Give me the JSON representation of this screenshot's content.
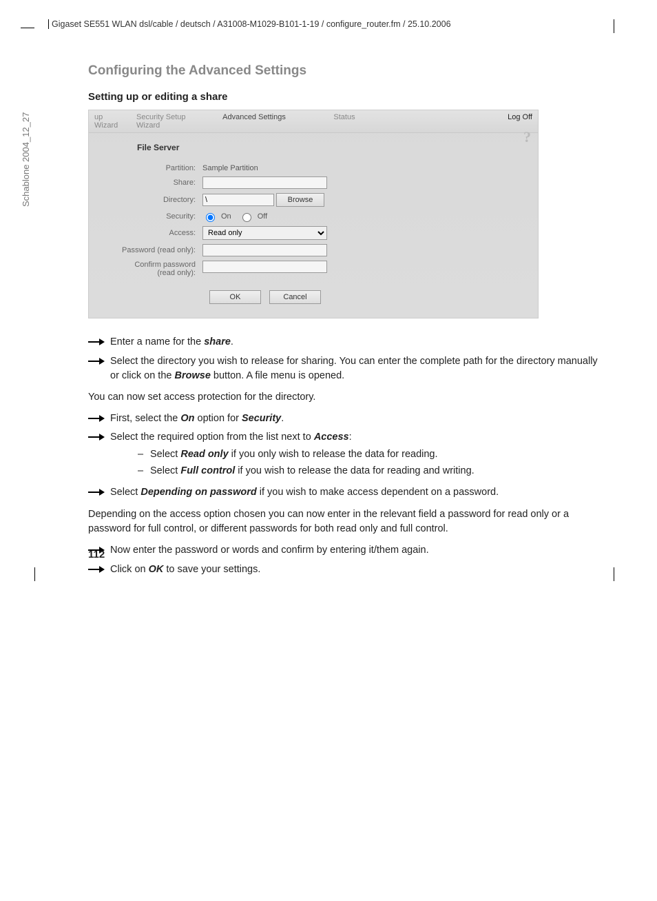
{
  "header_path": "Gigaset SE551 WLAN dsl/cable / deutsch / A31008-M1029-B101-1-19 / configure_router.fm / 25.10.2006",
  "side_label": "Schablone 2004_12_27",
  "section_title": "Configuring the Advanced Settings",
  "sub_title": "Setting up or editing a share",
  "screenshot": {
    "tabs": {
      "t1": "up Wizard",
      "t2": "Security Setup Wizard",
      "t3": "Advanced Settings",
      "t4": "Status"
    },
    "logoff": "Log Off",
    "help": "?",
    "panel_title": "File Server",
    "labels": {
      "partition": "Partition:",
      "share": "Share:",
      "directory": "Directory:",
      "security": "Security:",
      "access": "Access:",
      "pwd_ro": "Password (read only):",
      "cpwd_ro_1": "Confirm password",
      "cpwd_ro_2": "(read only):"
    },
    "values": {
      "partition": "Sample Partition",
      "directory": "\\",
      "access": "Read only"
    },
    "radio": {
      "on": "On",
      "off": "Off"
    },
    "buttons": {
      "browse": "Browse",
      "ok": "OK",
      "cancel": "Cancel"
    }
  },
  "instructions": {
    "i1_a": "Enter a name for the ",
    "i1_b": "share",
    "i1_c": ".",
    "i2_a": "Select the directory you wish to release for sharing. You can enter the complete path for the directory manually or click on the ",
    "i2_b": "Browse",
    "i2_c": " button. A file menu is opened.",
    "p1": "You can now set access protection for the directory.",
    "i3_a": "First, select the ",
    "i3_b": "On",
    "i3_c": " option for ",
    "i3_d": "Security",
    "i3_e": ".",
    "i4_a": "Select the required option from the list next to ",
    "i4_b": "Access",
    "i4_c": ":",
    "d1_a": "Select ",
    "d1_b": "Read only",
    "d1_c": " if you only wish to release the data for reading.",
    "d2_a": "Select ",
    "d2_b": "Full control",
    "d2_c": " if you wish to release the data for reading and writing.",
    "i5_a": "Select ",
    "i5_b": "Depending on password",
    "i5_c": " if you wish to make access dependent on a password.",
    "p2": "Depending on the access option chosen you can now enter in the relevant field a password for read only or a password for full control, or different passwords for both read only and full control.",
    "i6": "Now enter the password or words and confirm by entering it/them again.",
    "i7_a": "Click on ",
    "i7_b": "OK",
    "i7_c": " to save your settings."
  },
  "page_number": "112"
}
